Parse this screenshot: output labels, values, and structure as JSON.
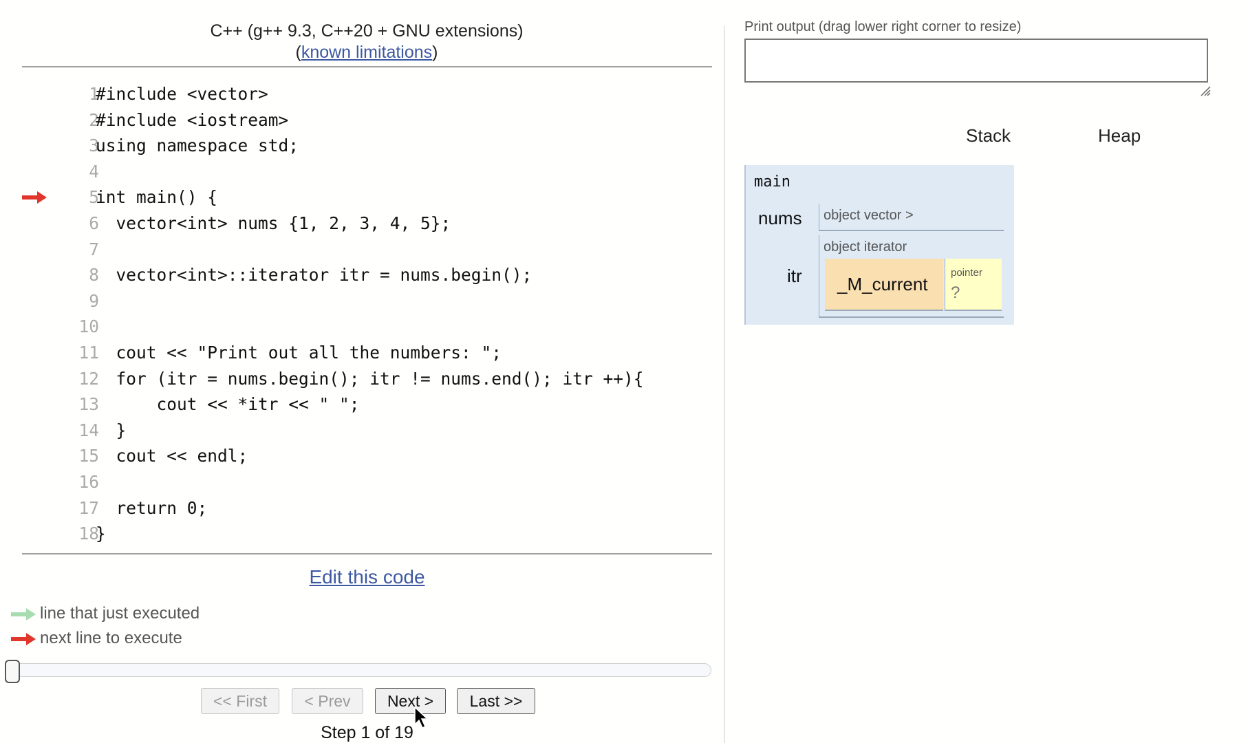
{
  "header": {
    "language": "C++ (g++ 9.3, C++20 + GNU extensions)",
    "limitations_open": "(",
    "limitations_link": "known limitations",
    "limitations_close": ")"
  },
  "code": {
    "current_line": 5,
    "lines": [
      {
        "n": "1",
        "text": "#include <vector>"
      },
      {
        "n": "2",
        "text": "#include <iostream>"
      },
      {
        "n": "3",
        "text": "using namespace std;"
      },
      {
        "n": "4",
        "text": ""
      },
      {
        "n": "5",
        "text": "int main() {"
      },
      {
        "n": "6",
        "text": "  vector<int> nums {1, 2, 3, 4, 5};"
      },
      {
        "n": "7",
        "text": ""
      },
      {
        "n": "8",
        "text": "  vector<int>::iterator itr = nums.begin();"
      },
      {
        "n": "9",
        "text": ""
      },
      {
        "n": "10",
        "text": ""
      },
      {
        "n": "11",
        "text": "  cout << \"Print out all the numbers: \";"
      },
      {
        "n": "12",
        "text": "  for (itr = nums.begin(); itr != nums.end(); itr ++){"
      },
      {
        "n": "13",
        "text": "      cout << *itr << \" \";"
      },
      {
        "n": "14",
        "text": "  }"
      },
      {
        "n": "15",
        "text": "  cout << endl;"
      },
      {
        "n": "16",
        "text": ""
      },
      {
        "n": "17",
        "text": "  return 0;"
      },
      {
        "n": "18",
        "text": "}"
      }
    ]
  },
  "edit_link": "Edit this code",
  "legend": {
    "executed": "line that just executed",
    "next": "next line to execute",
    "executed_color": "#a6dcb0",
    "next_color": "#e0362c"
  },
  "navigation": {
    "first": "<< First",
    "prev": "< Prev",
    "next": "Next >",
    "last": "Last >>",
    "step_text": "Step 1 of 19",
    "current_step": 1,
    "total_steps": 19
  },
  "output": {
    "label": "Print output (drag lower right corner to resize)",
    "text": ""
  },
  "visualization": {
    "stack_label": "Stack",
    "heap_label": "Heap",
    "frame": {
      "name": "main",
      "vars": {
        "nums": {
          "name": "nums",
          "value": "object vector >"
        },
        "itr": {
          "name": "itr",
          "type": "object iterator",
          "field": "_M_current",
          "pointer_label": "pointer",
          "pointer_value": "?"
        }
      }
    }
  }
}
